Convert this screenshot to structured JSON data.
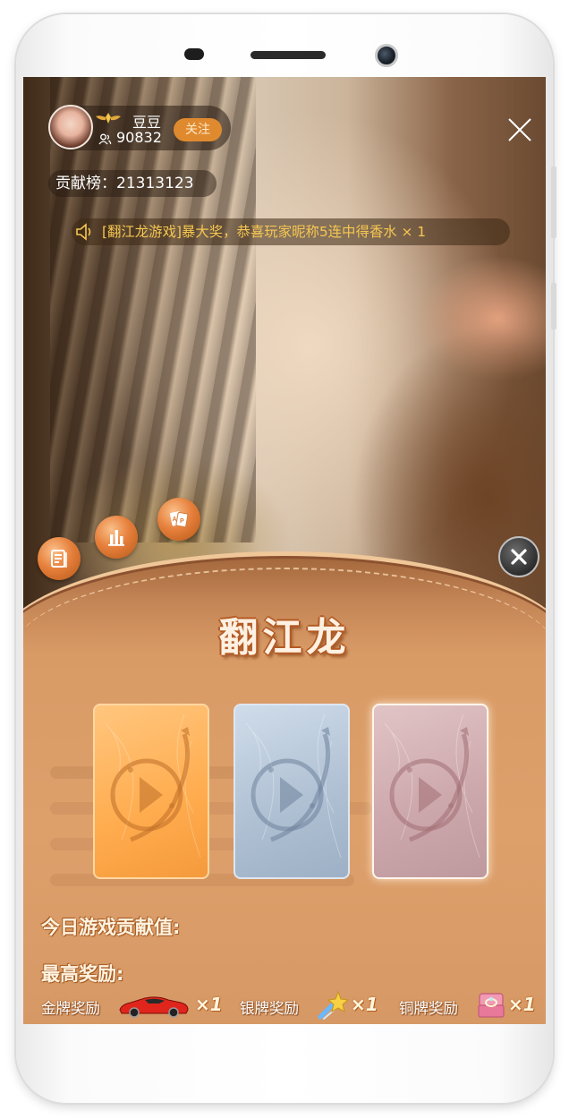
{
  "streamer": {
    "name": "豆豆",
    "viewer_count": "90832",
    "follow_label": "关注"
  },
  "contribution": {
    "text": "贡献榜：21313123"
  },
  "announcement": {
    "text": "[翻江龙游戏]暴大奖，恭喜玩家昵称5连中得香水 × 1"
  },
  "game": {
    "title": "翻江龙",
    "contribution_label": "今日游戏贡献值:",
    "max_reward_label": "最高奖励:",
    "rewards": [
      {
        "label": "金牌奖励",
        "icon": "sports-car-icon",
        "qty": "×1"
      },
      {
        "label": "银牌奖励",
        "icon": "shooting-star-icon",
        "qty": "×1"
      },
      {
        "label": "铜牌奖励",
        "icon": "ring-box-icon",
        "qty": "×1"
      }
    ],
    "cards": [
      {
        "tier": "gold",
        "color": "#ffb45a"
      },
      {
        "tier": "silver",
        "color": "#b5c5d8"
      },
      {
        "tier": "bronze",
        "color": "#d4b1b5"
      }
    ]
  },
  "colors": {
    "accent": "#e08a2f",
    "panel": "#dea06b",
    "announcement_text": "#f6c750"
  }
}
